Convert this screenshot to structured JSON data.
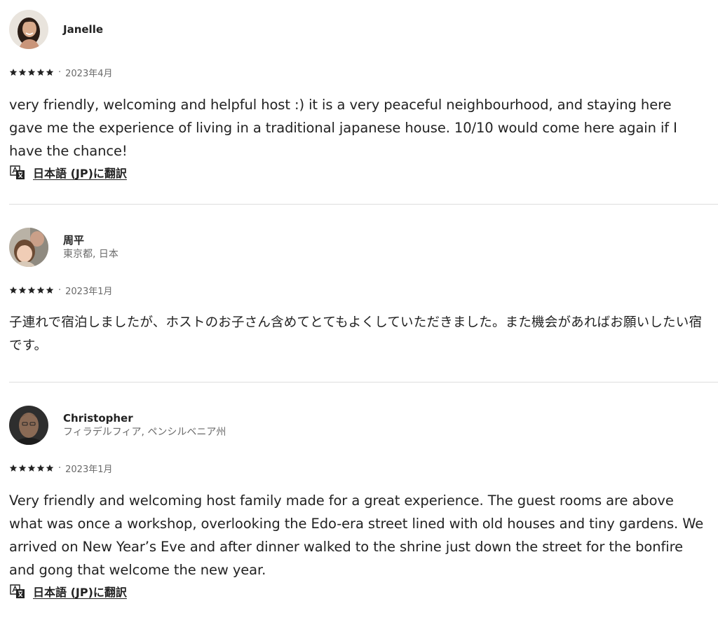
{
  "reviews": [
    {
      "name": "Janelle",
      "location": "",
      "rating": 5,
      "date": "2023年4月",
      "comment": "very friendly, welcoming and helpful host :) it is a very peaceful neighbourhood, and staying here gave me the experience of living in a traditional japanese house. 10/10 would come here again if I have the chance!",
      "translate_label": "日本語 (JP)に翻訳"
    },
    {
      "name": "周平",
      "location": "東京都, 日本",
      "rating": 5,
      "date": "2023年1月",
      "comment": "子連れで宿泊しましたが、ホストのお子さん含めてとてもよくしていただきました。また機会があればお願いしたい宿です。",
      "translate_label": ""
    },
    {
      "name": "Christopher",
      "location": "フィラデルフィア, ペンシルベニア州",
      "rating": 5,
      "date": "2023年1月",
      "comment": "Very friendly and welcoming host family made for a great experience. The guest rooms are above what was once a workshop, overlooking the Edo-era street lined with old houses and tiny gardens. We arrived on New Year’s Eve and after dinner walked to the shrine just down the street for the bonfire and gong that welcome the new year.",
      "translate_label": "日本語 (JP)に翻訳"
    }
  ],
  "separator": "·",
  "colors": {
    "text": "#222222",
    "muted": "#6a6a6a",
    "divider": "#dddddd"
  },
  "icons": {
    "star": "star-icon",
    "translate": "translate-icon"
  }
}
